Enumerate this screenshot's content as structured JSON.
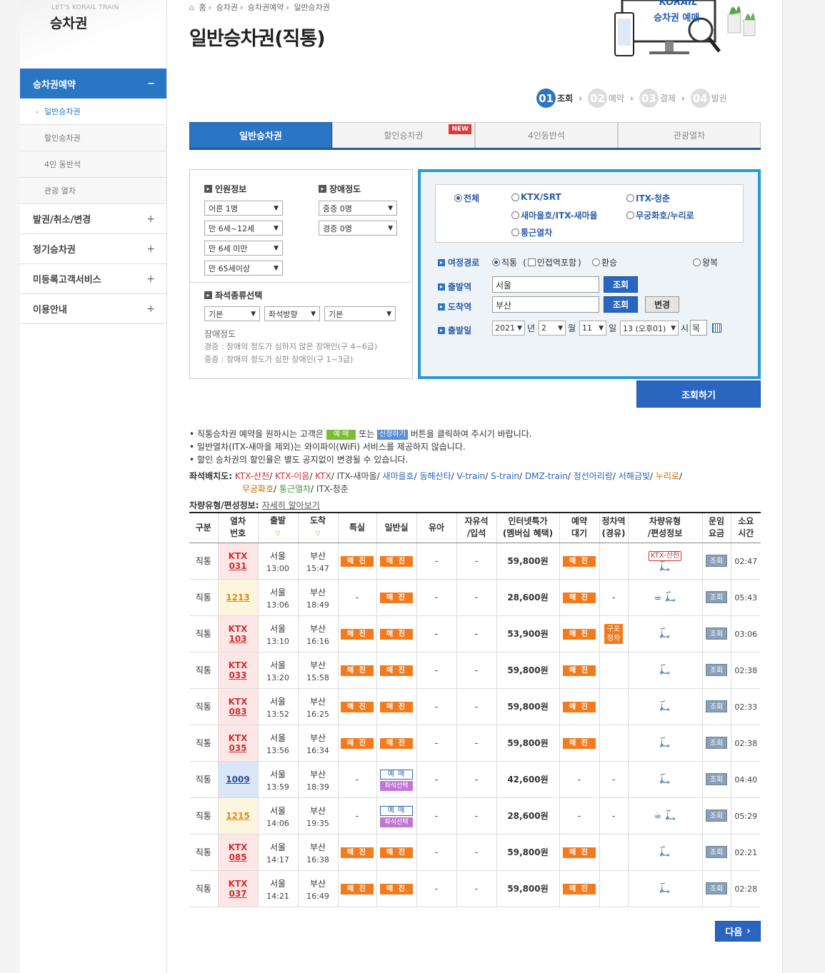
{
  "brand": {
    "sub": "LET'S KORAIL TRAIN",
    "title": "승차권"
  },
  "sidebar": {
    "main": {
      "label": "승차권예약",
      "toggle": "−"
    },
    "subs": [
      {
        "label": "일반승차권",
        "dash": "-"
      },
      {
        "label": "할인승차권"
      },
      {
        "label": "4인 동반석"
      },
      {
        "label": "관광 열차"
      }
    ],
    "groups": [
      {
        "label": "발권/취소/변경",
        "toggle": "+"
      },
      {
        "label": "정기승차권",
        "toggle": "+"
      },
      {
        "label": "미등록고객서비스",
        "toggle": "+"
      },
      {
        "label": "이용안내",
        "toggle": "+"
      }
    ]
  },
  "breadcrumb": [
    "홈",
    "승차권",
    "승차권예약",
    "일반승차권"
  ],
  "page_title": "일반승차권(직통)",
  "hero": {
    "logo": "KORAIL",
    "text": "승차권 예매"
  },
  "steps": [
    {
      "num": "01",
      "label": "조회"
    },
    {
      "num": "02",
      "label": "예약"
    },
    {
      "num": "03",
      "label": "결제"
    },
    {
      "num": "04",
      "label": "발권"
    }
  ],
  "arrow": "›",
  "tabs": [
    {
      "label": "일반승차권"
    },
    {
      "label": "할인승차권",
      "badge": "NEW"
    },
    {
      "label": "4인동반석"
    },
    {
      "label": "관광열차"
    }
  ],
  "passenger": {
    "title": "인원정보",
    "selects": [
      "어른 1명",
      "만 6세~12세",
      "만 6세 미만",
      "만 65세이상"
    ],
    "dis_title": "장애정도",
    "dis_selects": [
      "중증 0명",
      "경증 0명"
    ]
  },
  "seat": {
    "title": "좌석종류선택",
    "selects": [
      "기본",
      "좌석방향",
      "기본"
    ]
  },
  "dis_note": {
    "title": "장애정도",
    "line1": "경증 : 장애의 정도가 심하지 않은 장애인(구 4~6급)",
    "line2": "중증 : 장애의 정도가 심한 장애인(구 1~3급)"
  },
  "train_types": [
    {
      "label": "전체"
    },
    {
      "label": "KTX/SRT"
    },
    {
      "label": "ITX-청춘"
    },
    {
      "label": "새마을호/ITX-새마을"
    },
    {
      "label": "무궁화호/누리로"
    },
    {
      "label": "통근열차"
    }
  ],
  "route": {
    "label": "여정경로",
    "opt1": "직통",
    "opt1_extra": "(",
    "checkbox": "인접역포함",
    "opt1_close": ")",
    "opt2": "환승",
    "opt3": "왕복"
  },
  "dep": {
    "label": "출발역",
    "value": "서울",
    "btn": "조회"
  },
  "arr": {
    "label": "도착역",
    "value": "부산",
    "btn": "조회",
    "change": "변경"
  },
  "date": {
    "label": "출발일",
    "year": "2021",
    "year_u": "년",
    "month": "2",
    "month_u": "월",
    "day": "11",
    "day_u": "일",
    "hour": "13 (오후01)",
    "hour_u": "시",
    "dow": "목"
  },
  "search_btn": "조회하기",
  "info": {
    "l1a": "직통승차권 예약을 원하시는 고객은",
    "chip1": "예 매",
    "l1b": "또는",
    "chip2": "신청하기",
    "l1c": "버튼을 클릭하여 주시기 바랍니다.",
    "l2": "일반열차(ITX-새마을 제외)는 와이파이(WiFi) 서비스를 제공하지 않습니다.",
    "l3": "할인 승차권의 할인율은 별도 공지없이 변경될 수 있습니다.",
    "bullet": "•"
  },
  "seatmap": {
    "label": "좌석배치도:",
    "links": [
      "KTX-산천",
      "KTX-이음",
      "KTX",
      "ITX-새마을",
      "새마을호",
      "동해산타",
      "V-train",
      "S-train",
      "DMZ-train",
      "정선아리랑",
      "서해금빛",
      "누리로",
      "무궁화호",
      "통근열차",
      "ITX-청춘"
    ],
    "sep": "/"
  },
  "vehicle": {
    "label": "차량유형/편성정보:",
    "link": "자세히 알아보기"
  },
  "table": {
    "headers": [
      "구분",
      "열차\n번호",
      "출발",
      "도착",
      "특실",
      "일반실",
      "유아",
      "자유석\n/입석",
      "인터넷특가\n(멤버십 혜택)",
      "예약\n대기",
      "정차역\n(경유)",
      "차량유형\n/편성정보",
      "운임\n요금",
      "소요\n시간"
    ],
    "sort_mark": "▽",
    "rows": [
      {
        "type": "직통",
        "brand": "KTX",
        "no": "031",
        "cls": "k",
        "dep": "서울",
        "dt": "13:00",
        "arr": "부산",
        "at": "15:47",
        "sp": "매 진",
        "gen": "매 진",
        "gen2": "",
        "inf": "-",
        "free": "-",
        "fare": "59,800원",
        "wait": "매 진",
        "stop": "",
        "veh": "KTX-산천",
        "icons": "🛴",
        "fee": "조회",
        "dur": "02:47"
      },
      {
        "type": "직통",
        "brand": "",
        "no": "1213",
        "cls": "y",
        "dep": "서울",
        "dt": "13:06",
        "arr": "부산",
        "at": "18:49",
        "sp": "-",
        "gen": "매 진",
        "gen2": "",
        "inf": "-",
        "free": "-",
        "fare": "28,600원",
        "wait": "매 진",
        "stop": "-",
        "veh": "",
        "icons": "☕ 🛴",
        "fee": "조회",
        "dur": "05:43"
      },
      {
        "type": "직통",
        "brand": "KTX",
        "no": "103",
        "cls": "k",
        "dep": "서울",
        "dt": "13:10",
        "arr": "부산",
        "at": "16:16",
        "sp": "매 진",
        "gen": "매 진",
        "gen2": "",
        "inf": "-",
        "free": "-",
        "fare": "53,900원",
        "wait": "매 진",
        "stop": "구포\n정차",
        "veh": "",
        "icons": "🛴",
        "fee": "조회",
        "dur": "03:06"
      },
      {
        "type": "직통",
        "brand": "KTX",
        "no": "033",
        "cls": "k",
        "dep": "서울",
        "dt": "13:20",
        "arr": "부산",
        "at": "15:58",
        "sp": "매 진",
        "gen": "매 진",
        "gen2": "",
        "inf": "-",
        "free": "-",
        "fare": "59,800원",
        "wait": "매 진",
        "stop": "",
        "veh": "",
        "icons": "🛴",
        "fee": "조회",
        "dur": "02:38"
      },
      {
        "type": "직통",
        "brand": "KTX",
        "no": "083",
        "cls": "k",
        "dep": "서울",
        "dt": "13:52",
        "arr": "부산",
        "at": "16:25",
        "sp": "매 진",
        "gen": "매 진",
        "gen2": "",
        "inf": "-",
        "free": "-",
        "fare": "59,800원",
        "wait": "매 진",
        "stop": "",
        "veh": "",
        "icons": "🛴",
        "fee": "조회",
        "dur": "02:33"
      },
      {
        "type": "직통",
        "brand": "KTX",
        "no": "035",
        "cls": "k",
        "dep": "서울",
        "dt": "13:56",
        "arr": "부산",
        "at": "16:34",
        "sp": "매 진",
        "gen": "매 진",
        "gen2": "",
        "inf": "-",
        "free": "-",
        "fare": "59,800원",
        "wait": "매 진",
        "stop": "",
        "veh": "",
        "icons": "🛴",
        "fee": "조회",
        "dur": "02:38"
      },
      {
        "type": "직통",
        "brand": "",
        "no": "1009",
        "cls": "b",
        "dep": "서울",
        "dt": "13:59",
        "arr": "부산",
        "at": "18:39",
        "sp": "-",
        "gen": "예 매",
        "gen2": "좌석선택",
        "inf": "-",
        "free": "-",
        "fare": "42,600원",
        "wait": "-",
        "stop": "-",
        "veh": "",
        "icons": "🛴",
        "fee": "조회",
        "dur": "04:40"
      },
      {
        "type": "직통",
        "brand": "",
        "no": "1215",
        "cls": "y",
        "dep": "서울",
        "dt": "14:06",
        "arr": "부산",
        "at": "19:35",
        "sp": "-",
        "gen": "예 매",
        "gen2": "좌석선택",
        "inf": "-",
        "free": "-",
        "fare": "28,600원",
        "wait": "-",
        "stop": "-",
        "veh": "",
        "icons": "☕ 🛴",
        "fee": "조회",
        "dur": "05:29"
      },
      {
        "type": "직통",
        "brand": "KTX",
        "no": "085",
        "cls": "k",
        "dep": "서울",
        "dt": "14:17",
        "arr": "부산",
        "at": "16:38",
        "sp": "매 진",
        "gen": "매 진",
        "gen2": "",
        "inf": "-",
        "free": "-",
        "fare": "59,800원",
        "wait": "매 진",
        "stop": "",
        "veh": "",
        "icons": "🛴",
        "fee": "조회",
        "dur": "02:21"
      },
      {
        "type": "직통",
        "brand": "KTX",
        "no": "037",
        "cls": "k",
        "dep": "서울",
        "dt": "14:21",
        "arr": "부산",
        "at": "16:49",
        "sp": "매 진",
        "gen": "매 진",
        "gen2": "",
        "inf": "-",
        "free": "-",
        "fare": "59,800원",
        "wait": "매 진",
        "stop": "",
        "veh": "",
        "icons": "🛴",
        "fee": "조회",
        "dur": "02:28"
      }
    ]
  },
  "next_btn": "다음",
  "next_arrow": "›",
  "colors": {
    "primary": "#2a76c4",
    "soldout": "#f27b1f",
    "accent": "#2a9ad4"
  }
}
